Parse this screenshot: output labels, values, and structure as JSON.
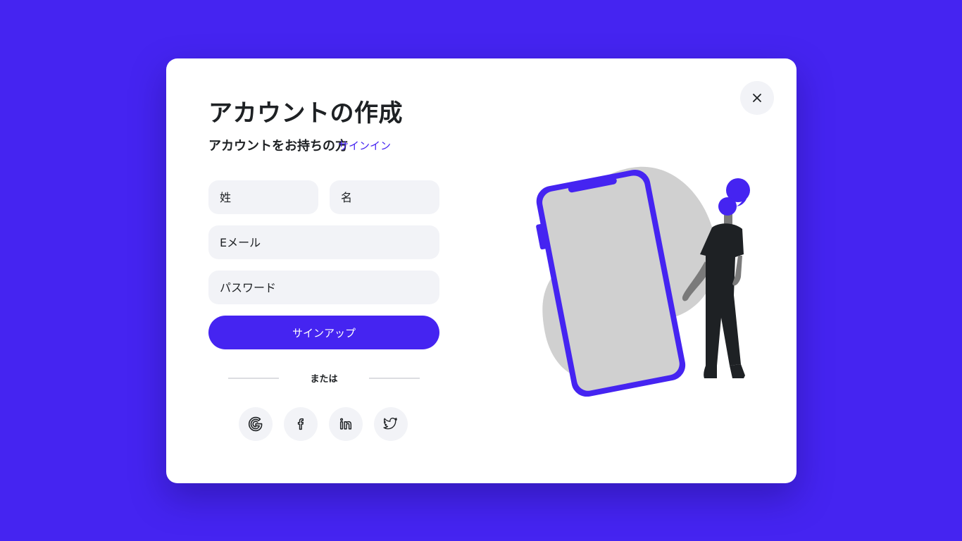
{
  "modal": {
    "title": "アカウントの作成",
    "subtitle": "アカウントをお持ちの方",
    "signin_link": "サインイン",
    "close_icon": "close-icon"
  },
  "form": {
    "last_name_placeholder": "姓",
    "first_name_placeholder": "名",
    "email_placeholder": "Eメール",
    "password_placeholder": "パスワード",
    "submit_label": "サインアップ"
  },
  "divider": {
    "label": "または"
  },
  "social": [
    {
      "icon": "google-icon"
    },
    {
      "icon": "facebook-icon"
    },
    {
      "icon": "linkedin-icon"
    },
    {
      "icon": "twitter-icon"
    }
  ],
  "colors": {
    "accent": "#4524f1",
    "background": "#4524f1",
    "field_bg": "#f2f3f7",
    "text": "#1e2124",
    "illustration_gray": "#d0d0d0"
  }
}
